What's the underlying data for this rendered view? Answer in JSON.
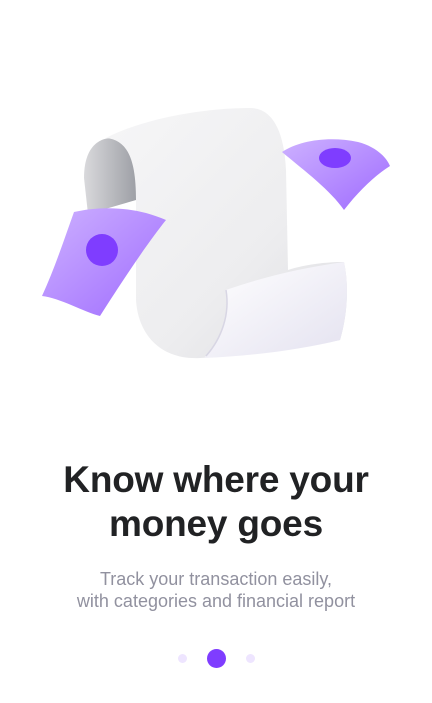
{
  "onboarding": {
    "title_line1": "Know where your",
    "title_line2": "money goes",
    "subtitle_line1": "Track your transaction easily,",
    "subtitle_line2": "with categories and financial report",
    "illustration_icon": "receipt-with-money-icon",
    "pager": {
      "total": 3,
      "active_index": 1
    }
  },
  "colors": {
    "accent": "#7F3DFF",
    "accent_light": "#EEE5FF",
    "money": "#B38BFF",
    "title": "#212224",
    "subtitle": "#91919F"
  }
}
